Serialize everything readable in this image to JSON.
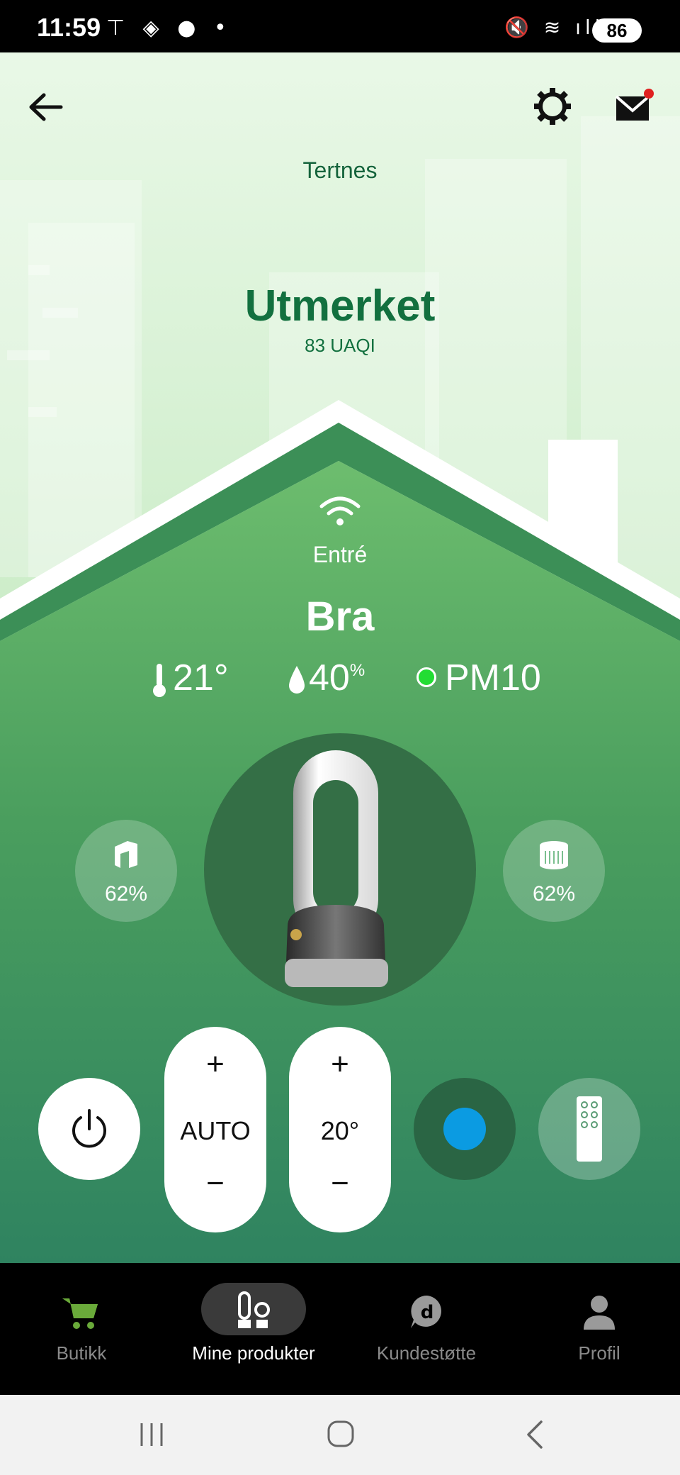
{
  "status_bar": {
    "time": "11:59",
    "battery": "86"
  },
  "header": {
    "location": "Tertnes"
  },
  "outdoor": {
    "quality": "Utmerket",
    "index": "83 UAQI"
  },
  "indoor": {
    "room": "Entré",
    "quality": "Bra",
    "temperature": "21°",
    "humidity": "40",
    "humidity_unit": "%",
    "pollutant": "PM10",
    "pollutant_status_color": "#22dd33"
  },
  "filters": {
    "left_filter": "62%",
    "right_filter": "62%"
  },
  "controls": {
    "fan_plus": "+",
    "fan_value": "AUTO",
    "fan_minus": "−",
    "temp_plus": "+",
    "temp_value": "20°",
    "temp_minus": "−"
  },
  "colors": {
    "accent_green": "#12703f",
    "house_green": "#3f9a5e",
    "blue_dot": "#0b9be2"
  },
  "nav": {
    "items": [
      {
        "label": "Butikk",
        "icon": "cart-icon"
      },
      {
        "label": "Mine produkter",
        "icon": "products-icon"
      },
      {
        "label": "Kundestøtte",
        "icon": "support-icon"
      },
      {
        "label": "Profil",
        "icon": "profile-icon"
      }
    ],
    "active": "Mine produkter"
  }
}
